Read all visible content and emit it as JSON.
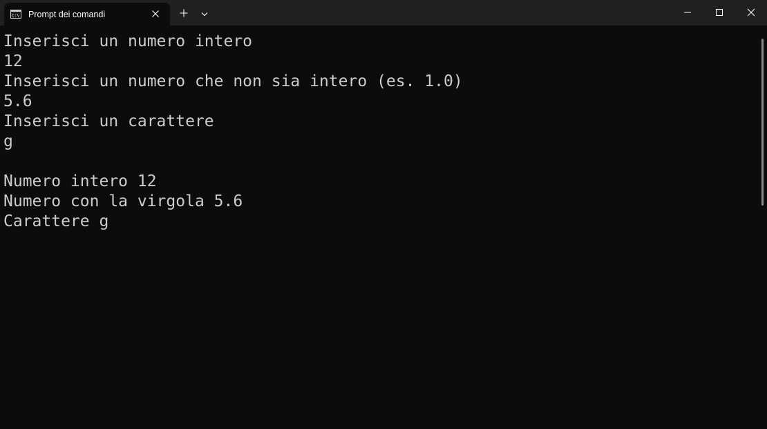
{
  "window": {
    "tab_title": "Prompt dei comandi",
    "icons": {
      "tab": "command-prompt-icon",
      "close_tab": "close-icon",
      "new_tab": "plus-icon",
      "dropdown": "chevron-down-icon",
      "minimize": "minimize-icon",
      "maximize": "maximize-icon",
      "close_window": "close-icon"
    }
  },
  "terminal": {
    "lines": [
      "Inserisci un numero intero",
      "12",
      "Inserisci un numero che non sia intero (es. 1.0)",
      "5.6",
      "Inserisci un carattere",
      "g",
      "",
      "Numero intero 12",
      "Numero con la virgola 5.6",
      "Carattere g"
    ]
  },
  "colors": {
    "background": "#0c0c0c",
    "titlebar": "#202020",
    "text": "#cccccc"
  }
}
